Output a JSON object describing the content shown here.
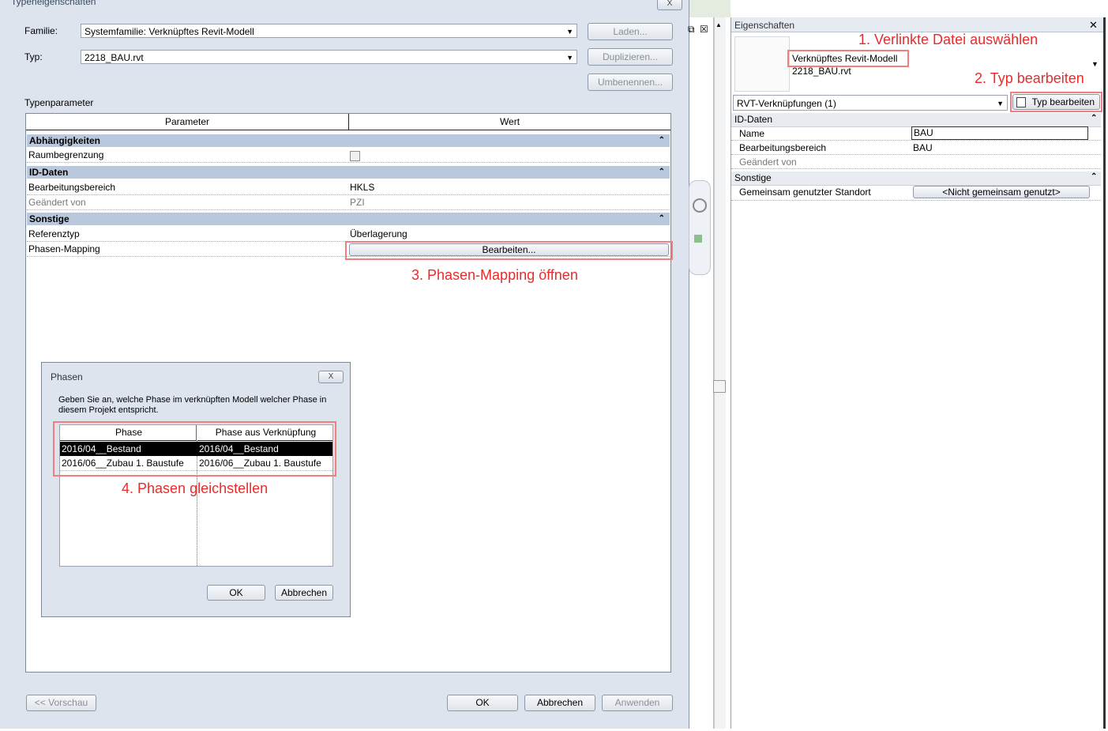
{
  "type_dialog": {
    "title": "Typeneigenschaften",
    "close": "X",
    "family_label": "Familie:",
    "family_value": "Systemfamilie: Verknüpftes Revit-Modell",
    "type_label": "Typ:",
    "type_value": "2218_BAU.rvt",
    "load_button": "Laden...",
    "duplicate_button": "Duplizieren...",
    "rename_button": "Umbenennen...",
    "type_params_label": "Typenparameter",
    "col_parameter": "Parameter",
    "col_value": "Wert",
    "sections": {
      "dependencies": "Abhängigkeiten",
      "id_data": "ID-Daten",
      "other": "Sonstige"
    },
    "rows": {
      "room_bounding": "Raumbegrenzung",
      "workset": "Bearbeitungsbereich",
      "workset_value": "HKLS",
      "edited_by": "Geändert von",
      "edited_by_value": "PZI",
      "reference_type": "Referenztyp",
      "reference_type_value": "Überlagerung",
      "phase_mapping": "Phasen-Mapping",
      "phase_mapping_button": "Bearbeiten..."
    },
    "preview_button": "<< Vorschau",
    "ok_button": "OK",
    "cancel_button": "Abbrechen",
    "apply_button": "Anwenden"
  },
  "annotations": {
    "step1": "1. Verlinkte Datei auswählen",
    "step2": "2. Typ bearbeiten",
    "step3": "3. Phasen-Mapping öffnen",
    "step4": "4. Phasen gleichstellen"
  },
  "properties_panel": {
    "title": "Eigenschaften",
    "close": "✕",
    "type_name": "Verknüpftes Revit-Modell",
    "type_file": "2218_BAU.rvt",
    "selector": "RVT-Verknüpfungen (1)",
    "edit_type_button": "Typ bearbeiten",
    "section_id": "ID-Daten",
    "name_label": "Name",
    "name_value": "BAU",
    "workset_label": "Bearbeitungsbereich",
    "workset_value": "BAU",
    "edited_by_label": "Geändert von",
    "section_other": "Sonstige",
    "shared_site_label": "Gemeinsam genutzter Standort",
    "shared_site_button": "<Nicht gemeinsam genutzt>"
  },
  "phases_dialog": {
    "title": "Phasen",
    "close": "X",
    "description": "Geben Sie an, welche Phase im verknüpften Modell welcher Phase in diesem Projekt entspricht.",
    "col_phase": "Phase",
    "col_linked_phase": "Phase aus Verknüpfung",
    "rows": [
      {
        "phase": "2016/04__Bestand",
        "linked": "2016/04__Bestand"
      },
      {
        "phase": "2016/06__Zubau 1. Baustufe",
        "linked": "2016/06__Zubau 1. Baustufe"
      }
    ],
    "ok_button": "OK",
    "cancel_button": "Abbrechen"
  },
  "view_tab_icons": {
    "restore": "⧉",
    "close": "☒"
  }
}
